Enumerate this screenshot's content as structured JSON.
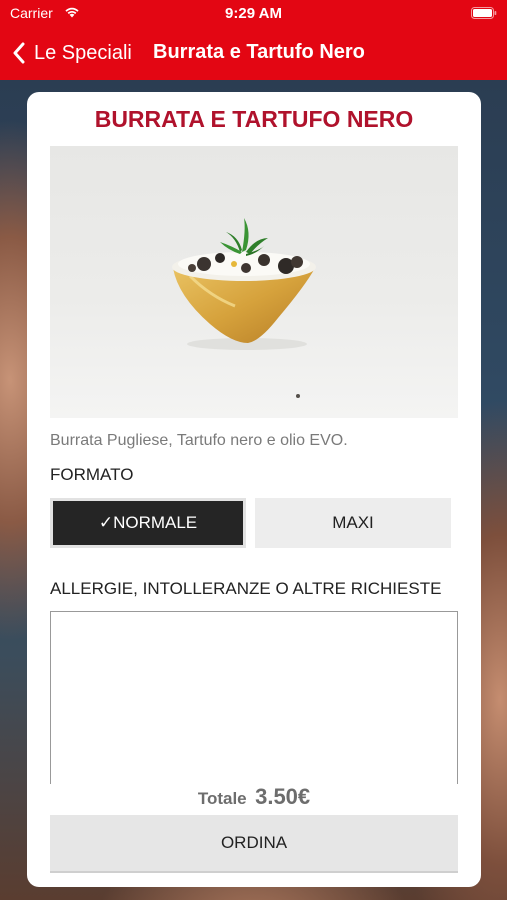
{
  "status_bar": {
    "carrier": "Carrier",
    "time": "9:29 AM"
  },
  "nav": {
    "back_label": "Le Speciali",
    "title": "Burrata e Tartufo Nero"
  },
  "product": {
    "title": "BURRATA E TARTUFO NERO",
    "description": "Burrata Pugliese, Tartufo nero e olio EVO.",
    "image_icon": "burrata-dish-photo"
  },
  "format": {
    "label": "FORMATO",
    "options": [
      {
        "label": "✓NORMALE",
        "selected": true
      },
      {
        "label": "MAXI",
        "selected": false
      }
    ]
  },
  "notes": {
    "label": "ALLERGIE, INTOLLERANZE O ALTRE RICHIESTE",
    "value": ""
  },
  "total": {
    "label": "Totale",
    "value": "3.50€"
  },
  "order": {
    "label": "ORDINA"
  },
  "colors": {
    "brand_red": "#e30613",
    "title_red": "#b0122c",
    "selected_bg": "#252525"
  }
}
